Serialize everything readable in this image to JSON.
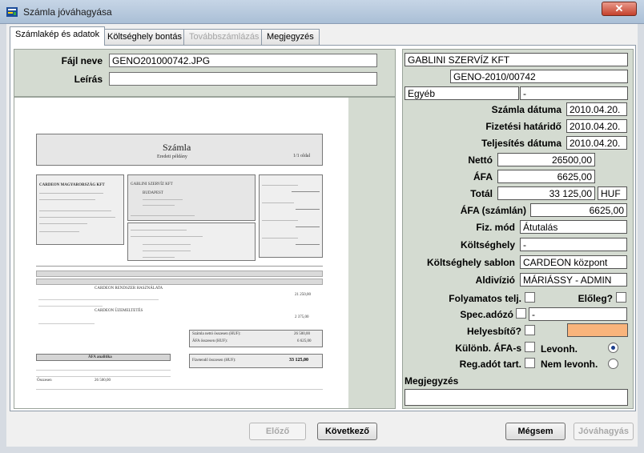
{
  "window": {
    "title": "Számla jóváhagyása",
    "close_label": "✕"
  },
  "tabs": [
    {
      "label": "Számlakép és adatok"
    },
    {
      "label": "Költséghely bontás"
    },
    {
      "label": "Továbbszámlázás"
    },
    {
      "label": "Megjegyzés"
    }
  ],
  "file": {
    "name_label": "Fájl neve",
    "name_value": "GENO201000742.JPG",
    "desc_label": "Leírás",
    "desc_value": ""
  },
  "invoice_preview": {
    "title": "Számla",
    "subtitle": "Eredeti példány",
    "page": "1/1 oldal",
    "seller": "CARDEON MAGYARORSZÁG KFT",
    "buyer": "GABLINI SZERVÍZ KFT",
    "buyer_city": "BUDAPEST",
    "item1": "CARDEON RENDSZER HASZNÁLATA",
    "item2": "CARDEON ÜZEMELTETÉS",
    "item1_total": "21 250,00",
    "item2_total": "2 375,00",
    "net_total_label": "Számla nettó összesen (HUF):",
    "net_total": "26 500,00",
    "vat_total_label": "ÁFA összesen (HUF):",
    "vat_total": "6 625,00",
    "vat_analysis": "ÁFA analitika",
    "summary_label": "Összesen",
    "summary_value": "26 500,00",
    "payable_label": "Fizetendő összesen (HUF):",
    "payable_value": "33 125,00"
  },
  "details": {
    "supplier": "GABLINI SZERVÍZ KFT",
    "invoice_no": "GENO-2010/00742",
    "category": "Egyéb",
    "category_extra": "-",
    "invoice_date_label": "Számla dátuma",
    "invoice_date": "2010.04.20.",
    "due_date_label": "Fizetési határidő",
    "due_date": "2010.04.20.",
    "fulfil_date_label": "Teljesítés dátuma",
    "fulfil_date": "2010.04.20.",
    "net_label": "Nettó",
    "net": "26500,00",
    "vat_label": "ÁFA",
    "vat": "6625,00",
    "total_label": "Totál",
    "total": "33 125,00",
    "currency": "HUF",
    "vat_invoice_label": "ÁFA (számlán)",
    "vat_invoice": "6625,00",
    "pay_mode_label": "Fiz. mód",
    "pay_mode": "Átutalás",
    "cost_center_label": "Költséghely",
    "cost_center": "-",
    "cost_template_label": "Költséghely sablon",
    "cost_template": "CARDEON központ",
    "division_label": "Aldivízió",
    "division": "MÁRIÁSSY - ADMIN",
    "continuous_label": "Folyamatos telj.",
    "advance_label": "Előleg?",
    "spec_tax_label": "Spec.adózó",
    "spec_tax_value": "-",
    "corrector_label": "Helyesbítő?",
    "corrector_color": "#f9b47c",
    "diff_vat_label": "Különb. ÁFA-s",
    "deductible_label": "Levonh.",
    "reg_tax_label": "Reg.adót tart.",
    "non_deductible_label": "Nem levonh.",
    "note_label": "Megjegyzés",
    "note_value": ""
  },
  "buttons": {
    "prev": "Előző",
    "next": "Következő",
    "cancel": "Mégsem",
    "approve": "Jóváhagyás"
  }
}
